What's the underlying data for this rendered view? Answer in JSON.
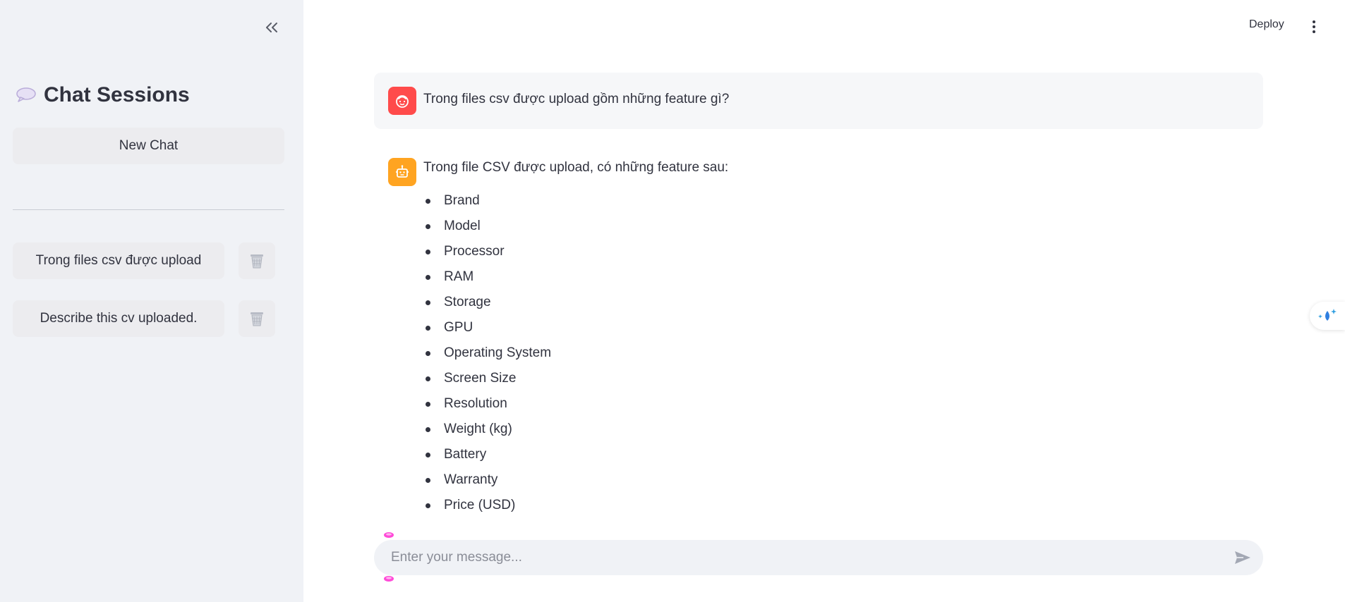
{
  "sidebar": {
    "title": "Chat Sessions",
    "title_icon": "speech-balloon-icon",
    "new_chat_label": "New Chat",
    "sessions": [
      {
        "label": "Trong files csv được upload"
      },
      {
        "label": "Describe this cv uploaded."
      }
    ]
  },
  "header": {
    "deploy_label": "Deploy"
  },
  "messages": {
    "user": {
      "text": "Trong files csv được upload gồm những feature gì?"
    },
    "assistant": {
      "intro": "Trong file CSV được upload, có những feature sau:",
      "features": [
        "Brand",
        "Model",
        "Processor",
        "RAM",
        "Storage",
        "GPU",
        "Operating System",
        "Screen Size",
        "Resolution",
        "Weight (kg)",
        "Battery",
        "Warranty",
        "Price (USD)"
      ]
    }
  },
  "input": {
    "placeholder": "Enter your message..."
  },
  "colors": {
    "sidebar_bg": "#f0f2f6",
    "user_avatar": "#ff4b4b",
    "assistant_avatar": "#ffa421",
    "text": "#31333f"
  }
}
